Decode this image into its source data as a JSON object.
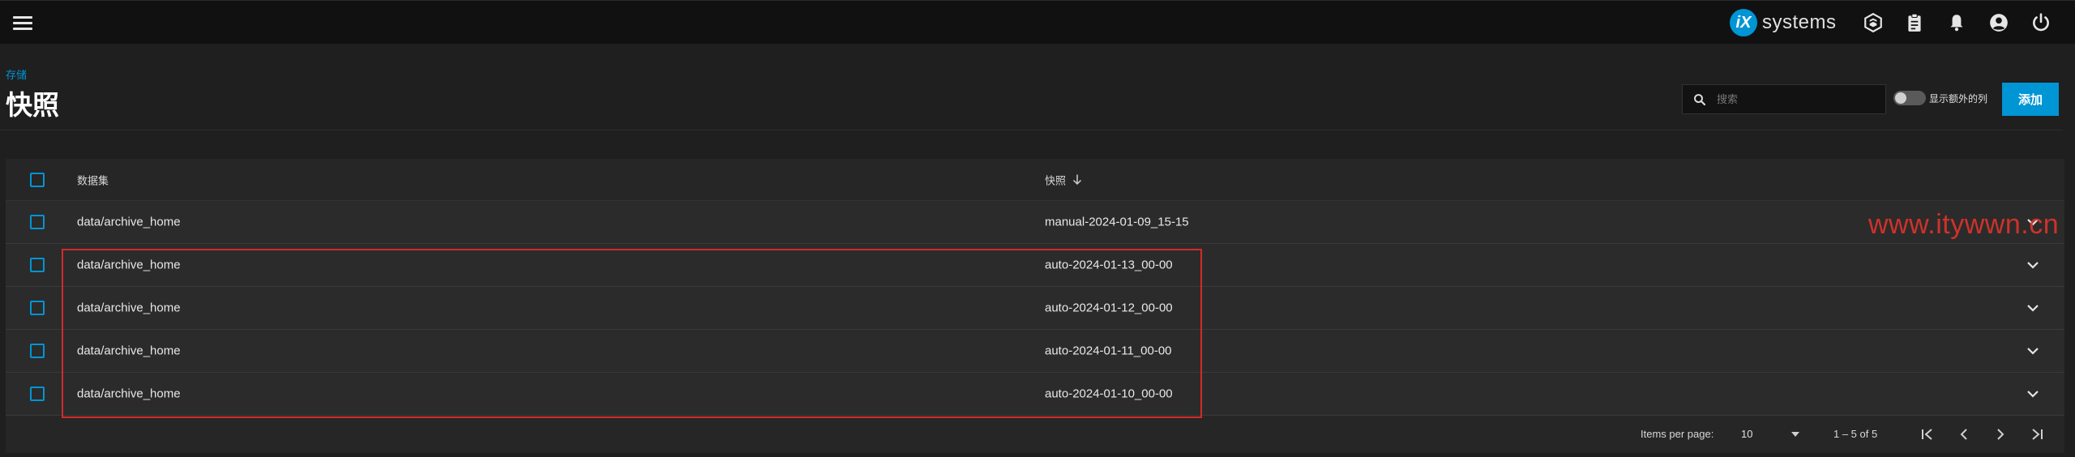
{
  "topbar": {
    "brand_mark": "iX",
    "brand_text": "systems",
    "icons": [
      "menu-icon",
      "truecommand-icon",
      "clipboard-icon",
      "bell-icon",
      "account-circle-icon",
      "power-icon"
    ]
  },
  "header": {
    "breadcrumb": "存储",
    "title": "快照",
    "search_placeholder": "搜索",
    "toggle_label": "显示额外的列",
    "add_label": "添加"
  },
  "table": {
    "columns": {
      "dataset": "数据集",
      "snapshot": "快照"
    },
    "rows": [
      {
        "dataset": "data/archive_home",
        "snapshot": "manual-2024-01-09_15-15"
      },
      {
        "dataset": "data/archive_home",
        "snapshot": "auto-2024-01-13_00-00"
      },
      {
        "dataset": "data/archive_home",
        "snapshot": "auto-2024-01-12_00-00"
      },
      {
        "dataset": "data/archive_home",
        "snapshot": "auto-2024-01-11_00-00"
      },
      {
        "dataset": "data/archive_home",
        "snapshot": "auto-2024-01-10_00-00"
      }
    ]
  },
  "paginator": {
    "items_per_page_label": "Items per page:",
    "items_per_page": "10",
    "range": "1 – 5 of 5"
  },
  "watermark": "www.itywwn.cn",
  "colors": {
    "accent": "#0095d5",
    "highlight": "#d42a2a"
  }
}
